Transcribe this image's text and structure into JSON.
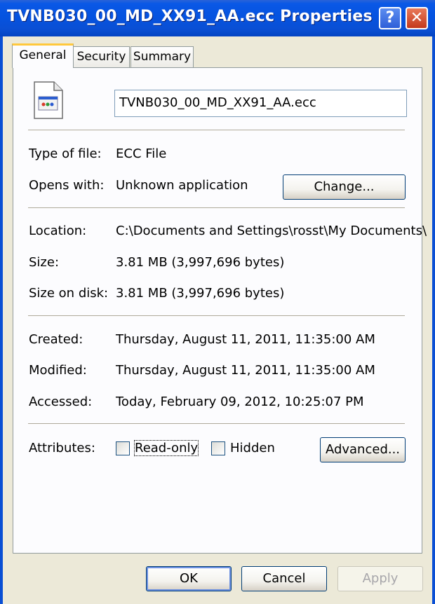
{
  "window": {
    "title": "TVNB030_00_MD_XX91_AA.ecc Properties",
    "help_glyph": "?",
    "close_glyph": "✕"
  },
  "tabs": [
    {
      "label": "General",
      "active": true
    },
    {
      "label": "Security",
      "active": false
    },
    {
      "label": "Summary",
      "active": false
    }
  ],
  "general": {
    "file_name": "TVNB030_00_MD_XX91_AA.ecc",
    "type_label": "Type of file:",
    "type_value": "ECC File",
    "opens_label": "Opens with:",
    "opens_value": "Unknown application",
    "change_label": "Change...",
    "location_label": "Location:",
    "location_value": "C:\\Documents and Settings\\rosst\\My Documents\\",
    "size_label": "Size:",
    "size_value": "3.81 MB (3,997,696 bytes)",
    "size_disk_label": "Size on disk:",
    "size_disk_value": "3.81 MB (3,997,696 bytes)",
    "created_label": "Created:",
    "created_value": "Thursday, August 11, 2011, 11:35:00 AM",
    "modified_label": "Modified:",
    "modified_value": "Thursday, August 11, 2011, 11:35:00 AM",
    "accessed_label": "Accessed:",
    "accessed_value": "Today, February 09, 2012, 10:25:07 PM",
    "attributes_label": "Attributes:",
    "readonly_label": "Read-only",
    "readonly_checked": false,
    "hidden_label": "Hidden",
    "hidden_checked": false,
    "advanced_label": "Advanced..."
  },
  "footer": {
    "ok_label": "OK",
    "cancel_label": "Cancel",
    "apply_label": "Apply",
    "apply_enabled": false
  }
}
